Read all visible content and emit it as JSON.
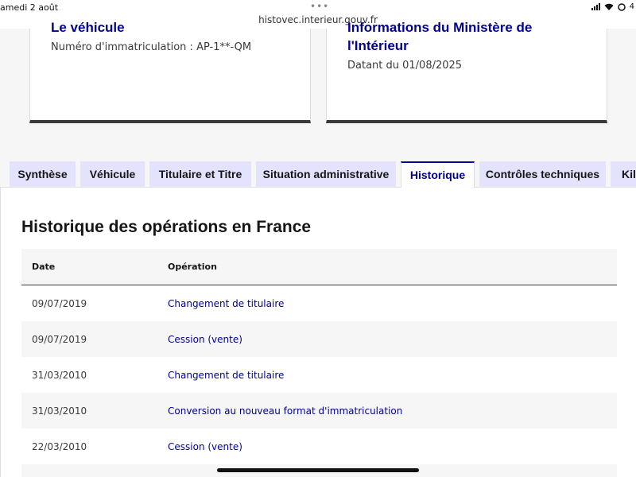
{
  "status_bar": {
    "time": "amedi 2 août",
    "dots": "•••",
    "url": "histovec.interieur.gouv.fr",
    "battery": "4"
  },
  "cards": {
    "left": {
      "title": "Le véhicule",
      "text": "Numéro d'immatriculation : AP-1**-QM"
    },
    "right": {
      "title_line1": "Informations du Ministère de",
      "title_line2": "l'Intérieur",
      "text": "Datant du 01/08/2025"
    }
  },
  "tabs": [
    {
      "label": "Synthèse"
    },
    {
      "label": "Véhicule"
    },
    {
      "label": "Titulaire et Titre"
    },
    {
      "label": "Situation administrative"
    },
    {
      "label": "Historique"
    },
    {
      "label": "Contrôles techniques"
    },
    {
      "label": "Kilo"
    }
  ],
  "history": {
    "title": "Historique des opérations en France",
    "headers": {
      "date": "Date",
      "operation": "Opération"
    },
    "rows": [
      {
        "date": "09/07/2019",
        "operation": "Changement de titulaire"
      },
      {
        "date": "09/07/2019",
        "operation": "Cession (vente)"
      },
      {
        "date": "31/03/2010",
        "operation": "Changement de titulaire"
      },
      {
        "date": "31/03/2010",
        "operation": "Conversion au nouveau format d'immatriculation"
      },
      {
        "date": "22/03/2010",
        "operation": "Cession (vente)"
      }
    ]
  }
}
